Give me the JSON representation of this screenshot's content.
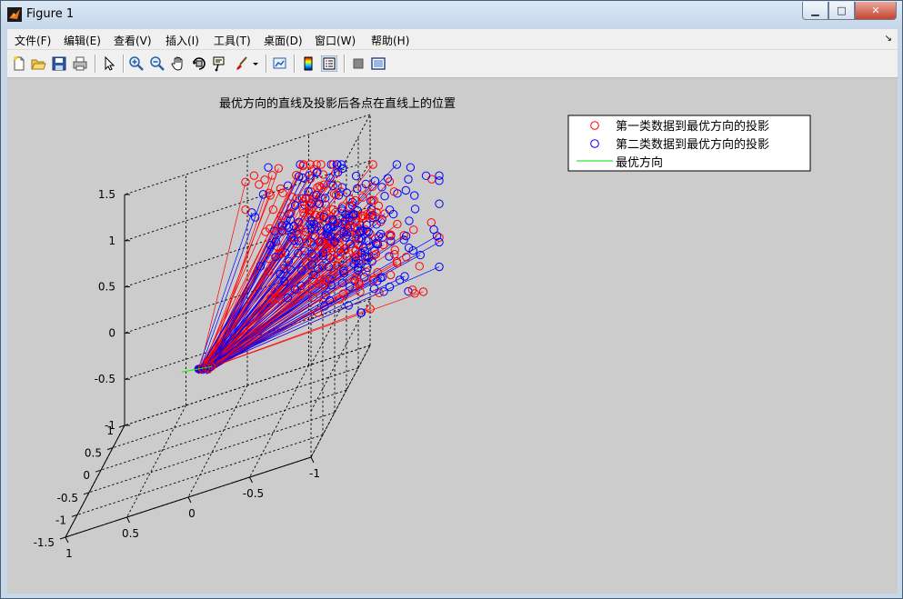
{
  "window": {
    "title": "Figure 1",
    "min_symbol": "▁",
    "max_symbol": "□",
    "close_symbol": "✕"
  },
  "menu": {
    "items": [
      "文件(F)",
      "编辑(E)",
      "查看(V)",
      "插入(I)",
      "工具(T)",
      "桌面(D)",
      "窗口(W)",
      "帮助(H)"
    ],
    "overflow_arrow": "↘"
  },
  "toolbar": {
    "icons": [
      "new-figure-icon",
      "open-file-icon",
      "save-icon",
      "print-icon",
      "select-arrow-icon",
      "zoom-in-icon",
      "zoom-out-icon",
      "pan-hand-icon",
      "rotate-3d-icon",
      "data-cursor-icon",
      "brush-icon",
      "brush-dropdown-icon",
      "link-plot-icon",
      "colorbar-icon",
      "legend-icon",
      "hide-plot-tools-icon",
      "show-plot-tools-icon"
    ]
  },
  "chart_data": {
    "type": "scatter",
    "title": "最优方向的直线及投影后各点在直线上的位置",
    "xlabel": "",
    "ylabel": "",
    "zlabel": "",
    "view": "3d",
    "xlim": [
      -1,
      1
    ],
    "ylim": [
      -1.5,
      1
    ],
    "zlim": [
      -1,
      1.5
    ],
    "x_ticks": [
      "-1",
      "-0.5",
      "0",
      "0.5",
      "1"
    ],
    "y_ticks": [
      "-1.5",
      "-1",
      "-0.5",
      "0",
      "0.5",
      "1"
    ],
    "z_ticks": [
      "-1",
      "-0.5",
      "0",
      "0.5",
      "1",
      "1.5"
    ],
    "grid": true,
    "legend_position": "top-right",
    "colors": {
      "class1": "#ff0000",
      "class2": "#0000ff",
      "line": "#00ff00"
    },
    "series": [
      {
        "name": "第一类数据到最优方向的投影",
        "marker": "circle",
        "color": "#ff0000"
      },
      {
        "name": "第二类数据到最优方向的投影",
        "marker": "circle",
        "color": "#0000ff"
      },
      {
        "name": "最优方向",
        "marker": "line",
        "color": "#00ff00"
      }
    ],
    "projection_point": [
      0.05,
      -0.6,
      -0.05
    ]
  }
}
